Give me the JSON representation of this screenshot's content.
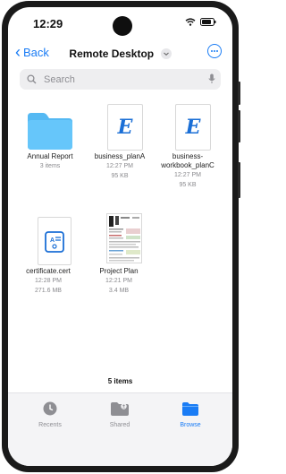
{
  "status": {
    "time": "12:29"
  },
  "nav": {
    "back_label": "Back",
    "title": "Remote Desktop"
  },
  "search": {
    "placeholder": "Search"
  },
  "items": [
    {
      "name": "Annual Report",
      "meta1": "3 items",
      "meta2": "",
      "icon": "folder-icon"
    },
    {
      "name": "business_planA",
      "meta1": "12:27 PM",
      "meta2": "95 KB",
      "icon": "word-doc-icon"
    },
    {
      "name": "business-workbook_planC",
      "meta1": "12:27 PM",
      "meta2": "95 KB",
      "icon": "word-doc-icon"
    },
    {
      "name": "certificate.cert",
      "meta1": "12:28 PM",
      "meta2": "271.6 MB",
      "icon": "certificate-icon"
    },
    {
      "name": "Project Plan",
      "meta1": "12:21 PM",
      "meta2": "3.4 MB",
      "icon": "document-preview-icon"
    }
  ],
  "item_count": "5 items",
  "tabs": [
    {
      "label": "Recents",
      "icon": "clock-icon",
      "active": false
    },
    {
      "label": "Shared",
      "icon": "shared-folder-icon",
      "active": false
    },
    {
      "label": "Browse",
      "icon": "folder-icon",
      "active": true
    }
  ],
  "colors": {
    "accent": "#1a7cf5",
    "folder": "#55b9f3",
    "word": "#1b6fd6"
  }
}
